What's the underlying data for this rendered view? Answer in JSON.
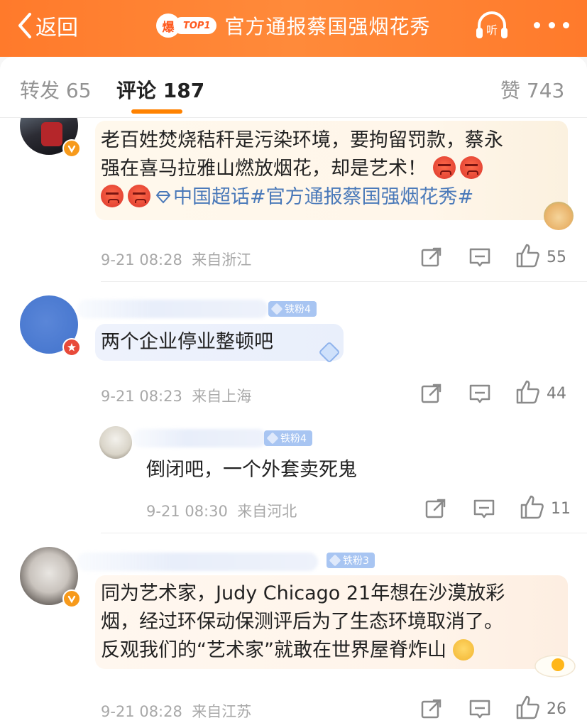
{
  "header": {
    "back_label": "返回",
    "hot_badge": "爆",
    "rank_badge": "TOP1",
    "title": "官方通报蔡国强烟花秀",
    "listen_label": "听",
    "colors": {
      "accent": "#ff7a2b"
    }
  },
  "tabs": {
    "repost": "转发 65",
    "comments": "评论 187",
    "likes": "赞 743"
  },
  "comments": [
    {
      "text_a": "老百姓焚烧秸秆是污染环境，要拘留罚款，蔡永",
      "text_b": "强在喜马拉雅山燃放烟花，却是艺术！",
      "topic": "中国超话#官方通报蔡国强烟花秀#",
      "time": "9-21 08:28",
      "location": "来自浙江",
      "likes": "55"
    },
    {
      "fan_badge": "铁粉4",
      "text": "两个企业停业整顿吧",
      "time": "9-21 08:23",
      "location": "来自上海",
      "likes": "44"
    },
    {
      "fan_badge": "铁粉4",
      "text": "倒闭吧，一个外套卖死鬼",
      "time": "9-21 08:30",
      "location": "来自河北",
      "likes": "11"
    },
    {
      "fan_badge": "铁粉3",
      "text_a": "同为艺术家，Judy Chicago 21年想在沙漠放彩",
      "text_b": "烟，经过环保动保测评后为了生态环境取消了。",
      "text_c": "反观我们的“艺术家”就敢在世界屋脊炸山",
      "time": "9-21 08:28",
      "location": "来自江苏",
      "likes": "26"
    }
  ]
}
